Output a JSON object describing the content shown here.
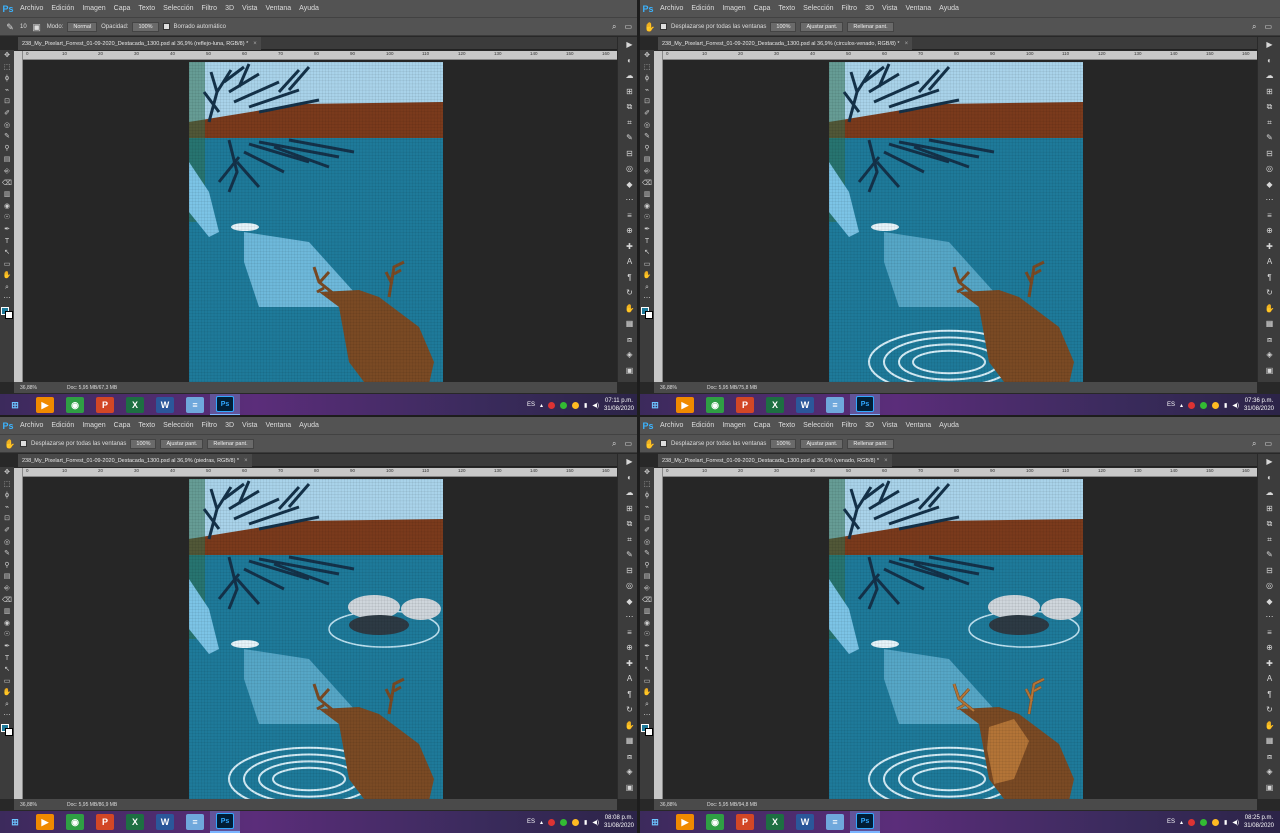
{
  "app": {
    "logo": "Ps",
    "menus": [
      "Archivo",
      "Edición",
      "Imagen",
      "Capa",
      "Texto",
      "Selección",
      "Filtro",
      "3D",
      "Vista",
      "Ventana",
      "Ayuda"
    ]
  },
  "options_eraser": {
    "brush_size": "10",
    "mode_label": "Modo:",
    "mode_value": "Normal",
    "opacity_label": "Opacidad:",
    "opacity_value": "100%",
    "auto_erase_label": "Borrado automático"
  },
  "options_hand": {
    "scroll_all_label": "Desplazarse por todas las ventanas",
    "zoom_100": "100%",
    "fit_screen": "Ajustar pant.",
    "fill_screen": "Rellenar pant."
  },
  "panes": [
    {
      "tab_title": "238_My_Pixelart_Forrest_01-09-2020_Destacada_1300.psd al 36,9% (reflejo-luna, RGB/8) *",
      "zoom": "36,88%",
      "doc_info": "Doc: 5,95 MB/67,3 MB",
      "time": "07:11 p.m.",
      "date": "31/08/2020"
    },
    {
      "tab_title": "238_My_Pixelart_Forrest_01-09-2020_Destacada_1300.psd al 36,9% (circulos-venado, RGB/8) *",
      "zoom": "36,88%",
      "doc_info": "Doc: 5,95 MB/75,8 MB",
      "time": "07:36 p.m.",
      "date": "31/08/2020"
    },
    {
      "tab_title": "238_My_Pixelart_Forrest_01-09-2020_Destacada_1300.psd al 36,9% (piedras, RGB/8) *",
      "zoom": "36,88%",
      "doc_info": "Doc: 5,95 MB/86,9 MB",
      "time": "08:08 p.m.",
      "date": "31/08/2020"
    },
    {
      "tab_title": "238_My_Pixelart_Forrest_01-09-2020_Destacada_1300.psd al 36,9% (venado, RGB/8) *",
      "zoom": "36,88%",
      "doc_info": "Doc: 5,95 MB/94,8 MB",
      "time": "08:25 p.m.",
      "date": "31/08/2020"
    }
  ],
  "ruler_labels": [
    "0",
    "10",
    "20",
    "30",
    "40",
    "50",
    "60",
    "70",
    "80",
    "90",
    "100",
    "110",
    "120",
    "130",
    "140",
    "150",
    "160"
  ],
  "taskbar": {
    "lang": "ES",
    "apps": [
      {
        "icon": "media-player-icon",
        "glyph": "▶",
        "color": "#f08a00"
      },
      {
        "icon": "chrome-icon",
        "glyph": "◉",
        "color": "#2f9e44"
      },
      {
        "icon": "powerpoint-icon",
        "glyph": "P",
        "color": "#d24726"
      },
      {
        "icon": "excel-icon",
        "glyph": "X",
        "color": "#1d6f42"
      },
      {
        "icon": "word-icon",
        "glyph": "W",
        "color": "#2b579a"
      },
      {
        "icon": "notepad-icon",
        "glyph": "≡",
        "color": "#6fa8dc"
      },
      {
        "icon": "photoshop-icon",
        "glyph": "Ps",
        "color": "#001e36"
      }
    ]
  },
  "colors": {
    "sky": "#a9d3ea",
    "water": "#1e7a9a",
    "bank": "#7a3a1c",
    "deer": "#7a4a24",
    "deer_light": "#b9793a",
    "tree": "#14324a",
    "light": "#7cc4e6"
  }
}
